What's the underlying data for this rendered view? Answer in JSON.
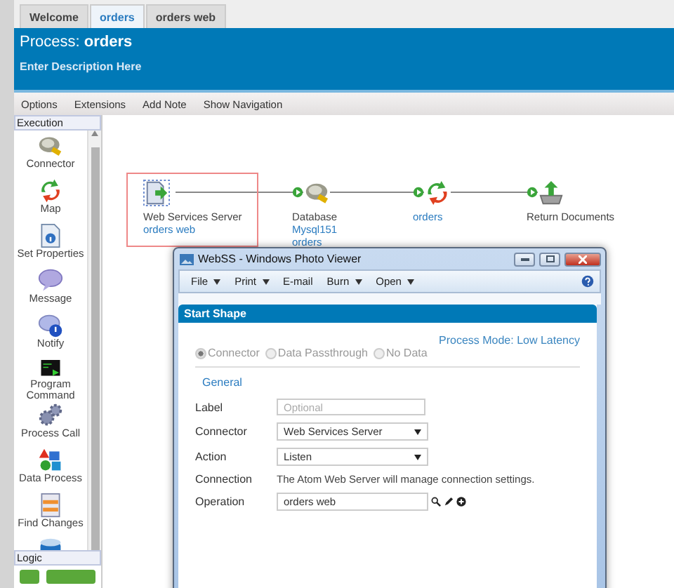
{
  "tabs": [
    {
      "label": "Welcome",
      "selected": false
    },
    {
      "label": "orders",
      "selected": true
    },
    {
      "label": "orders web",
      "selected": false
    }
  ],
  "header": {
    "title": "Process: **orders**",
    "description": "Enter Description Here"
  },
  "toolbar": [
    "Options",
    "Extensions",
    "Add Note",
    "Show Navigation"
  ],
  "sidebar": {
    "sections": [
      {
        "title": "Execution",
        "items": [
          {
            "kind": "connector",
            "label": "Connector"
          },
          {
            "kind": "map",
            "label": "Map"
          },
          {
            "kind": "properties",
            "label": "Set Properties"
          },
          {
            "kind": "message",
            "label": "Message"
          },
          {
            "kind": "notify",
            "label": "Notify"
          },
          {
            "kind": "program",
            "label": "Program Command"
          },
          {
            "kind": "process-call",
            "label": "Process Call"
          },
          {
            "kind": "data-process",
            "label": "Data Process"
          },
          {
            "kind": "find-changes",
            "label": "Find Changes"
          },
          {
            "kind": "cache"
          }
        ]
      },
      {
        "title": "Logic"
      }
    ]
  },
  "diagram": {
    "nodes": [
      {
        "kind": "start",
        "title": "Web Services Server",
        "links": [
          "orders web"
        ],
        "selected": true
      },
      {
        "kind": "connector",
        "title": "Database",
        "links": [
          "Mysql151",
          "orders"
        ],
        "selected": false
      },
      {
        "kind": "map",
        "links": [
          "orders"
        ],
        "selected": false
      },
      {
        "kind": "return",
        "title": "Return Documents",
        "selected": false
      }
    ]
  },
  "viewer": {
    "title": "WebSS - Windows Photo Viewer",
    "menu": [
      {
        "label": "File",
        "dropdown": true
      },
      {
        "label": "Print",
        "dropdown": true
      },
      {
        "label": "E-mail",
        "dropdown": false
      },
      {
        "label": "Burn",
        "dropdown": true
      },
      {
        "label": "Open",
        "dropdown": true
      }
    ],
    "panel": {
      "title": "Start Shape",
      "mode": "Process Mode: Low Latency",
      "radios": [
        {
          "label": "Connector",
          "selected": true
        },
        {
          "label": "Data Passthrough",
          "selected": false
        },
        {
          "label": "No Data",
          "selected": false
        }
      ],
      "section": "General",
      "rows": [
        {
          "kind": "field",
          "label": "Label",
          "placeholder": "Optional"
        },
        {
          "kind": "select",
          "label": "Connector",
          "value": "Web Services Server"
        },
        {
          "kind": "select",
          "label": "Action",
          "value": "Listen"
        },
        {
          "kind": "text",
          "label": "Connection",
          "value": "The Atom Web Server will manage connection settings."
        },
        {
          "kind": "operation",
          "label": "Operation",
          "value": "orders web"
        }
      ]
    }
  }
}
